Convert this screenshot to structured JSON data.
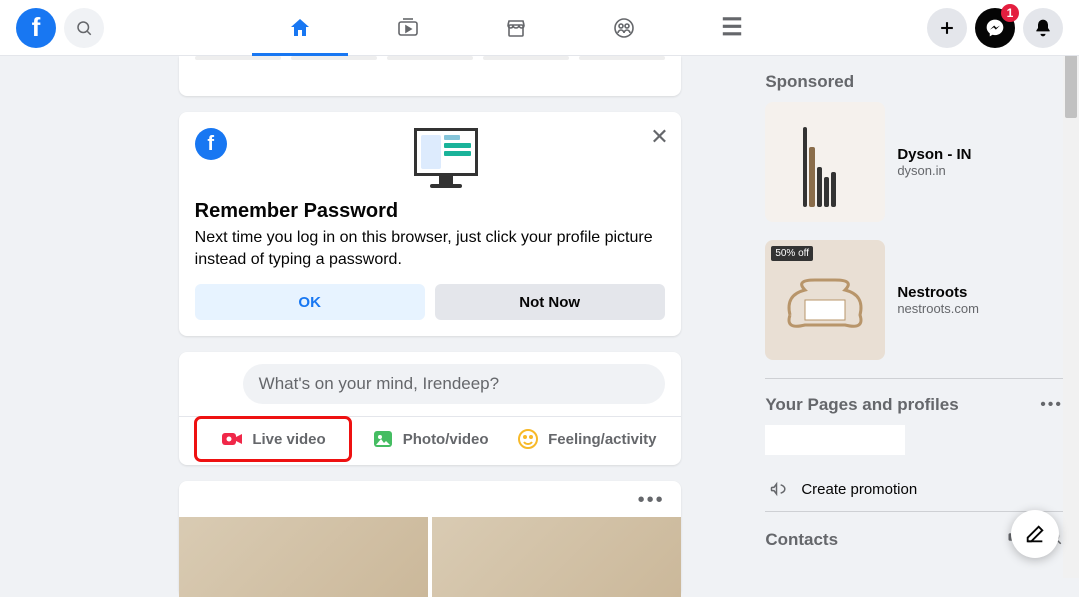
{
  "topbar": {
    "messenger_badge": "1"
  },
  "remember_password": {
    "title": "Remember Password",
    "text": "Next time you log in on this browser, just click your profile picture instead of typing a password.",
    "ok_label": "OK",
    "not_now_label": "Not Now"
  },
  "composer": {
    "placeholder": "What's on your mind, Irendeep?",
    "live_label": "Live video",
    "photo_label": "Photo/video",
    "feeling_label": "Feeling/activity"
  },
  "right": {
    "sponsored_title": "Sponsored",
    "ads": [
      {
        "title": "Dyson - IN",
        "domain": "dyson.in"
      },
      {
        "title": "Nestroots",
        "domain": "nestroots.com",
        "sale": "50% off"
      }
    ],
    "pages_title": "Your Pages and profiles",
    "create_promo": "Create promotion",
    "contacts_title": "Contacts"
  }
}
